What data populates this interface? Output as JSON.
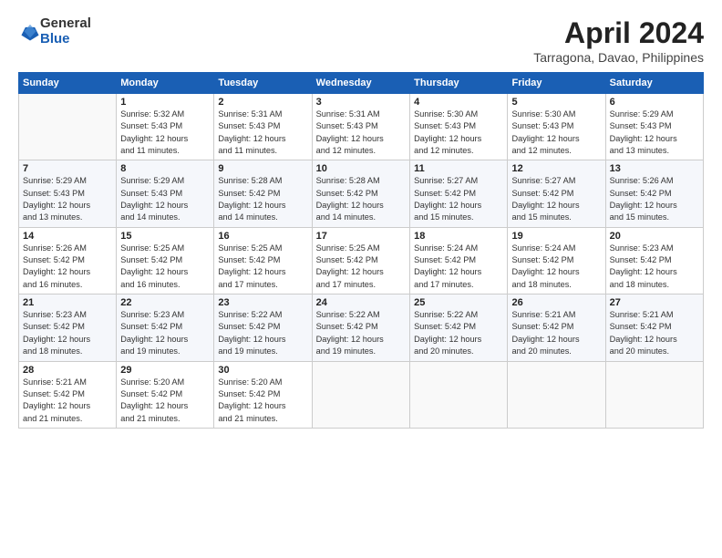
{
  "logo": {
    "general": "General",
    "blue": "Blue"
  },
  "title": "April 2024",
  "location": "Tarragona, Davao, Philippines",
  "headers": [
    "Sunday",
    "Monday",
    "Tuesday",
    "Wednesday",
    "Thursday",
    "Friday",
    "Saturday"
  ],
  "weeks": [
    [
      {
        "day": "",
        "info": ""
      },
      {
        "day": "1",
        "info": "Sunrise: 5:32 AM\nSunset: 5:43 PM\nDaylight: 12 hours\nand 11 minutes."
      },
      {
        "day": "2",
        "info": "Sunrise: 5:31 AM\nSunset: 5:43 PM\nDaylight: 12 hours\nand 11 minutes."
      },
      {
        "day": "3",
        "info": "Sunrise: 5:31 AM\nSunset: 5:43 PM\nDaylight: 12 hours\nand 12 minutes."
      },
      {
        "day": "4",
        "info": "Sunrise: 5:30 AM\nSunset: 5:43 PM\nDaylight: 12 hours\nand 12 minutes."
      },
      {
        "day": "5",
        "info": "Sunrise: 5:30 AM\nSunset: 5:43 PM\nDaylight: 12 hours\nand 12 minutes."
      },
      {
        "day": "6",
        "info": "Sunrise: 5:29 AM\nSunset: 5:43 PM\nDaylight: 12 hours\nand 13 minutes."
      }
    ],
    [
      {
        "day": "7",
        "info": "Sunrise: 5:29 AM\nSunset: 5:43 PM\nDaylight: 12 hours\nand 13 minutes."
      },
      {
        "day": "8",
        "info": "Sunrise: 5:29 AM\nSunset: 5:43 PM\nDaylight: 12 hours\nand 14 minutes."
      },
      {
        "day": "9",
        "info": "Sunrise: 5:28 AM\nSunset: 5:42 PM\nDaylight: 12 hours\nand 14 minutes."
      },
      {
        "day": "10",
        "info": "Sunrise: 5:28 AM\nSunset: 5:42 PM\nDaylight: 12 hours\nand 14 minutes."
      },
      {
        "day": "11",
        "info": "Sunrise: 5:27 AM\nSunset: 5:42 PM\nDaylight: 12 hours\nand 15 minutes."
      },
      {
        "day": "12",
        "info": "Sunrise: 5:27 AM\nSunset: 5:42 PM\nDaylight: 12 hours\nand 15 minutes."
      },
      {
        "day": "13",
        "info": "Sunrise: 5:26 AM\nSunset: 5:42 PM\nDaylight: 12 hours\nand 15 minutes."
      }
    ],
    [
      {
        "day": "14",
        "info": "Sunrise: 5:26 AM\nSunset: 5:42 PM\nDaylight: 12 hours\nand 16 minutes."
      },
      {
        "day": "15",
        "info": "Sunrise: 5:25 AM\nSunset: 5:42 PM\nDaylight: 12 hours\nand 16 minutes."
      },
      {
        "day": "16",
        "info": "Sunrise: 5:25 AM\nSunset: 5:42 PM\nDaylight: 12 hours\nand 17 minutes."
      },
      {
        "day": "17",
        "info": "Sunrise: 5:25 AM\nSunset: 5:42 PM\nDaylight: 12 hours\nand 17 minutes."
      },
      {
        "day": "18",
        "info": "Sunrise: 5:24 AM\nSunset: 5:42 PM\nDaylight: 12 hours\nand 17 minutes."
      },
      {
        "day": "19",
        "info": "Sunrise: 5:24 AM\nSunset: 5:42 PM\nDaylight: 12 hours\nand 18 minutes."
      },
      {
        "day": "20",
        "info": "Sunrise: 5:23 AM\nSunset: 5:42 PM\nDaylight: 12 hours\nand 18 minutes."
      }
    ],
    [
      {
        "day": "21",
        "info": "Sunrise: 5:23 AM\nSunset: 5:42 PM\nDaylight: 12 hours\nand 18 minutes."
      },
      {
        "day": "22",
        "info": "Sunrise: 5:23 AM\nSunset: 5:42 PM\nDaylight: 12 hours\nand 19 minutes."
      },
      {
        "day": "23",
        "info": "Sunrise: 5:22 AM\nSunset: 5:42 PM\nDaylight: 12 hours\nand 19 minutes."
      },
      {
        "day": "24",
        "info": "Sunrise: 5:22 AM\nSunset: 5:42 PM\nDaylight: 12 hours\nand 19 minutes."
      },
      {
        "day": "25",
        "info": "Sunrise: 5:22 AM\nSunset: 5:42 PM\nDaylight: 12 hours\nand 20 minutes."
      },
      {
        "day": "26",
        "info": "Sunrise: 5:21 AM\nSunset: 5:42 PM\nDaylight: 12 hours\nand 20 minutes."
      },
      {
        "day": "27",
        "info": "Sunrise: 5:21 AM\nSunset: 5:42 PM\nDaylight: 12 hours\nand 20 minutes."
      }
    ],
    [
      {
        "day": "28",
        "info": "Sunrise: 5:21 AM\nSunset: 5:42 PM\nDaylight: 12 hours\nand 21 minutes."
      },
      {
        "day": "29",
        "info": "Sunrise: 5:20 AM\nSunset: 5:42 PM\nDaylight: 12 hours\nand 21 minutes."
      },
      {
        "day": "30",
        "info": "Sunrise: 5:20 AM\nSunset: 5:42 PM\nDaylight: 12 hours\nand 21 minutes."
      },
      {
        "day": "",
        "info": ""
      },
      {
        "day": "",
        "info": ""
      },
      {
        "day": "",
        "info": ""
      },
      {
        "day": "",
        "info": ""
      }
    ]
  ]
}
